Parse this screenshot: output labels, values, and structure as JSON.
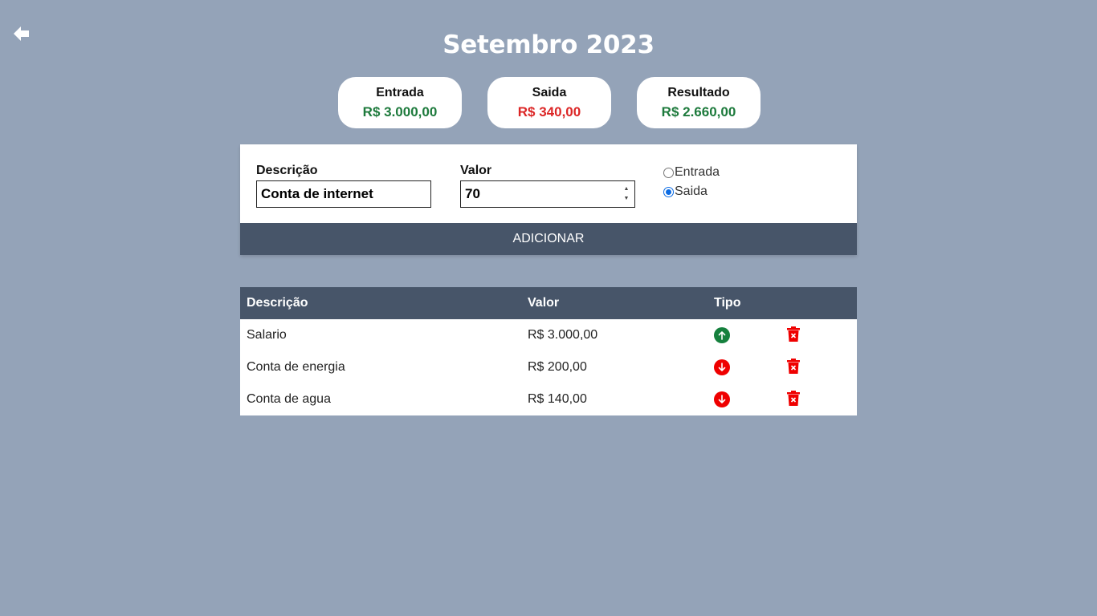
{
  "header": {
    "title": "Setembro 2023"
  },
  "summary": [
    {
      "label": "Entrada",
      "value": "R$ 3.000,00",
      "color": "#1d7a3c"
    },
    {
      "label": "Saida",
      "value": "R$ 340,00",
      "color": "#dc2626"
    },
    {
      "label": "Resultado",
      "value": "R$ 2.660,00",
      "color": "#1d7a3c"
    }
  ],
  "form": {
    "description_label": "Descrição",
    "description_value": "Conta de internet",
    "value_label": "Valor",
    "value_value": "70",
    "type_options": [
      {
        "label": "Entrada",
        "checked": false
      },
      {
        "label": "Saida",
        "checked": true
      }
    ],
    "add_button_label": "ADICIONAR"
  },
  "table": {
    "headers": [
      "Descrição",
      "Valor",
      "Tipo",
      ""
    ],
    "rows": [
      {
        "description": "Salario",
        "value": "R$ 3.000,00",
        "type": "entrada",
        "icon": "arrow-up-circle-icon"
      },
      {
        "description": "Conta de energia",
        "value": "R$ 200,00",
        "type": "saida",
        "icon": "arrow-down-circle-icon"
      },
      {
        "description": "Conta de agua",
        "value": "R$ 140,00",
        "type": "saida",
        "icon": "arrow-down-circle-icon"
      }
    ]
  },
  "colors": {
    "background": "#94a3b8",
    "header_bg": "#475569",
    "entrada_green": "#15803d",
    "saida_red": "#ef0000"
  }
}
